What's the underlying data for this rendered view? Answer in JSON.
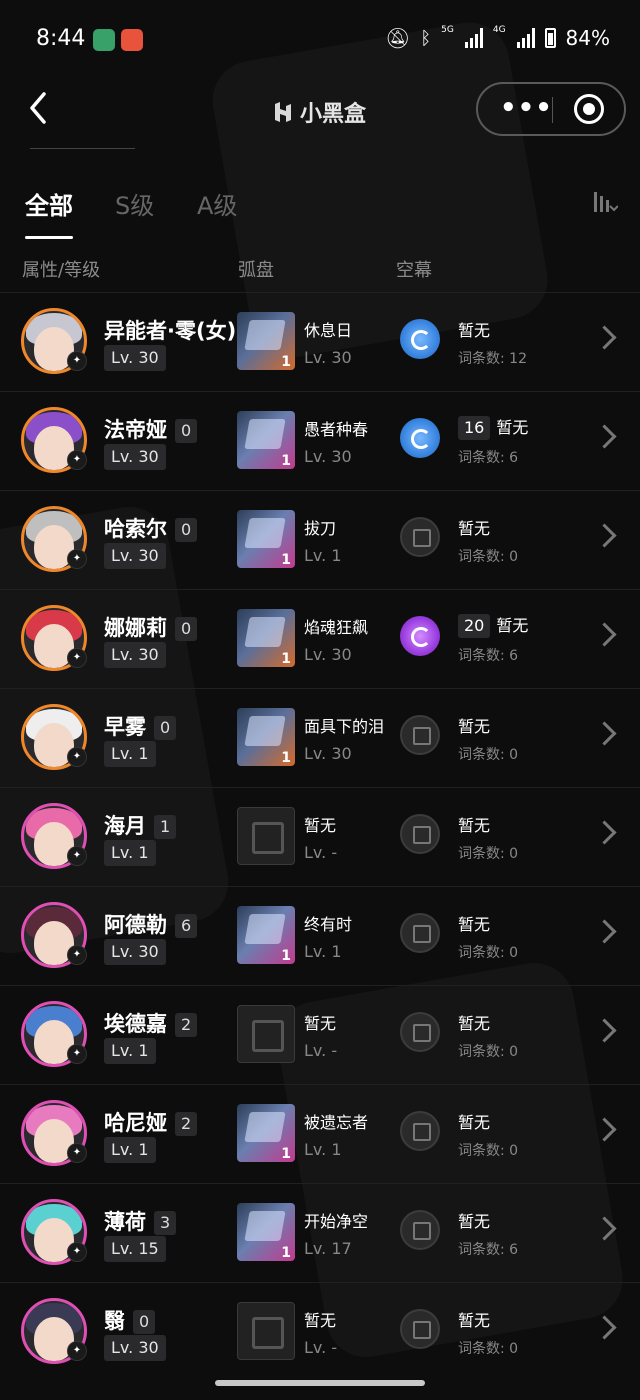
{
  "status_bar": {
    "time": "8:44",
    "net_5g": "5G",
    "net_4g": "4G",
    "battery": "84%"
  },
  "nav": {
    "title": "小黑盒"
  },
  "tabs": [
    {
      "label": "全部",
      "active": true
    },
    {
      "label": "S级",
      "active": false
    },
    {
      "label": "A级",
      "active": false
    }
  ],
  "columns": {
    "attr_level": "属性/等级",
    "disc": "弧盘",
    "core": "空幕"
  },
  "rows": [
    {
      "name": "异能者·零(女)",
      "tag": "",
      "level": "Lv. 30",
      "border": "orange",
      "hair": "#c7c7d2",
      "elem": "✦",
      "disc_name": "休息日",
      "disc_level": "Lv. 30",
      "disc_num": "1",
      "disc_style": "orange",
      "core_style": "blue",
      "core_num": "",
      "core_value": "暂无",
      "core_count": "词条数: 12"
    },
    {
      "name": "法帝娅",
      "tag": "0",
      "level": "Lv. 30",
      "border": "orange",
      "hair": "#8a4fc9",
      "elem": "✦",
      "disc_name": "愚者种春",
      "disc_level": "Lv. 30",
      "disc_num": "1",
      "disc_style": "pink",
      "core_style": "blue",
      "core_num": "16",
      "core_value": "暂无",
      "core_count": "词条数: 6"
    },
    {
      "name": "哈索尔",
      "tag": "0",
      "level": "Lv. 30",
      "border": "orange",
      "hair": "#bfbfbf",
      "elem": "✦",
      "disc_name": "拔刀",
      "disc_level": "Lv. 1",
      "disc_num": "1",
      "disc_style": "pink",
      "core_style": "gray",
      "core_num": "",
      "core_value": "暂无",
      "core_count": "词条数: 0"
    },
    {
      "name": "娜娜莉",
      "tag": "0",
      "level": "Lv. 30",
      "border": "orange",
      "hair": "#d83a4a",
      "elem": "✦",
      "disc_name": "焰魂狂飙",
      "disc_level": "Lv. 30",
      "disc_num": "1",
      "disc_style": "orange",
      "core_style": "purple",
      "core_num": "20",
      "core_value": "暂无",
      "core_count": "词条数: 6"
    },
    {
      "name": "早雾",
      "tag": "0",
      "level": "Lv. 1",
      "border": "orange",
      "hair": "#eeeeee",
      "elem": "✦",
      "disc_name": "面具下的泪",
      "disc_level": "Lv. 30",
      "disc_num": "1",
      "disc_style": "orange",
      "core_style": "gray",
      "core_num": "",
      "core_value": "暂无",
      "core_count": "词条数: 0"
    },
    {
      "name": "海月",
      "tag": "1",
      "level": "Lv. 1",
      "border": "pink",
      "hair": "#e86aa8",
      "elem": "✦",
      "disc_name": "暂无",
      "disc_level": "Lv. -",
      "disc_num": "",
      "disc_style": "empty",
      "core_style": "gray",
      "core_num": "",
      "core_value": "暂无",
      "core_count": "词条数: 0"
    },
    {
      "name": "阿德勒",
      "tag": "6",
      "level": "Lv. 30",
      "border": "pink",
      "hair": "#5a2a3a",
      "elem": "✦",
      "disc_name": "终有时",
      "disc_level": "Lv. 1",
      "disc_num": "1",
      "disc_style": "pink",
      "core_style": "gray",
      "core_num": "",
      "core_value": "暂无",
      "core_count": "词条数: 0"
    },
    {
      "name": "埃德嘉",
      "tag": "2",
      "level": "Lv. 1",
      "border": "pink",
      "hair": "#4a7fd0",
      "elem": "✦",
      "disc_name": "暂无",
      "disc_level": "Lv. -",
      "disc_num": "",
      "disc_style": "empty",
      "core_style": "gray",
      "core_num": "",
      "core_value": "暂无",
      "core_count": "词条数: 0"
    },
    {
      "name": "哈尼娅",
      "tag": "2",
      "level": "Lv. 1",
      "border": "pink",
      "hair": "#e87ac0",
      "elem": "✦",
      "disc_name": "被遗忘者",
      "disc_level": "Lv. 1",
      "disc_num": "1",
      "disc_style": "pink",
      "core_style": "gray",
      "core_num": "",
      "core_value": "暂无",
      "core_count": "词条数: 0"
    },
    {
      "name": "薄荷",
      "tag": "3",
      "level": "Lv. 15",
      "border": "pink",
      "hair": "#5ad0d0",
      "elem": "✦",
      "disc_name": "开始净空",
      "disc_level": "Lv. 17",
      "disc_num": "1",
      "disc_style": "pink",
      "core_style": "gray",
      "core_num": "",
      "core_value": "暂无",
      "core_count": "词条数: 6"
    },
    {
      "name": "翳",
      "tag": "0",
      "level": "Lv. 30",
      "border": "pink",
      "hair": "#3a3a55",
      "elem": "✦",
      "disc_name": "暂无",
      "disc_level": "Lv. -",
      "disc_num": "",
      "disc_style": "empty",
      "core_style": "gray",
      "core_num": "",
      "core_value": "暂无",
      "core_count": "词条数: 0"
    }
  ]
}
